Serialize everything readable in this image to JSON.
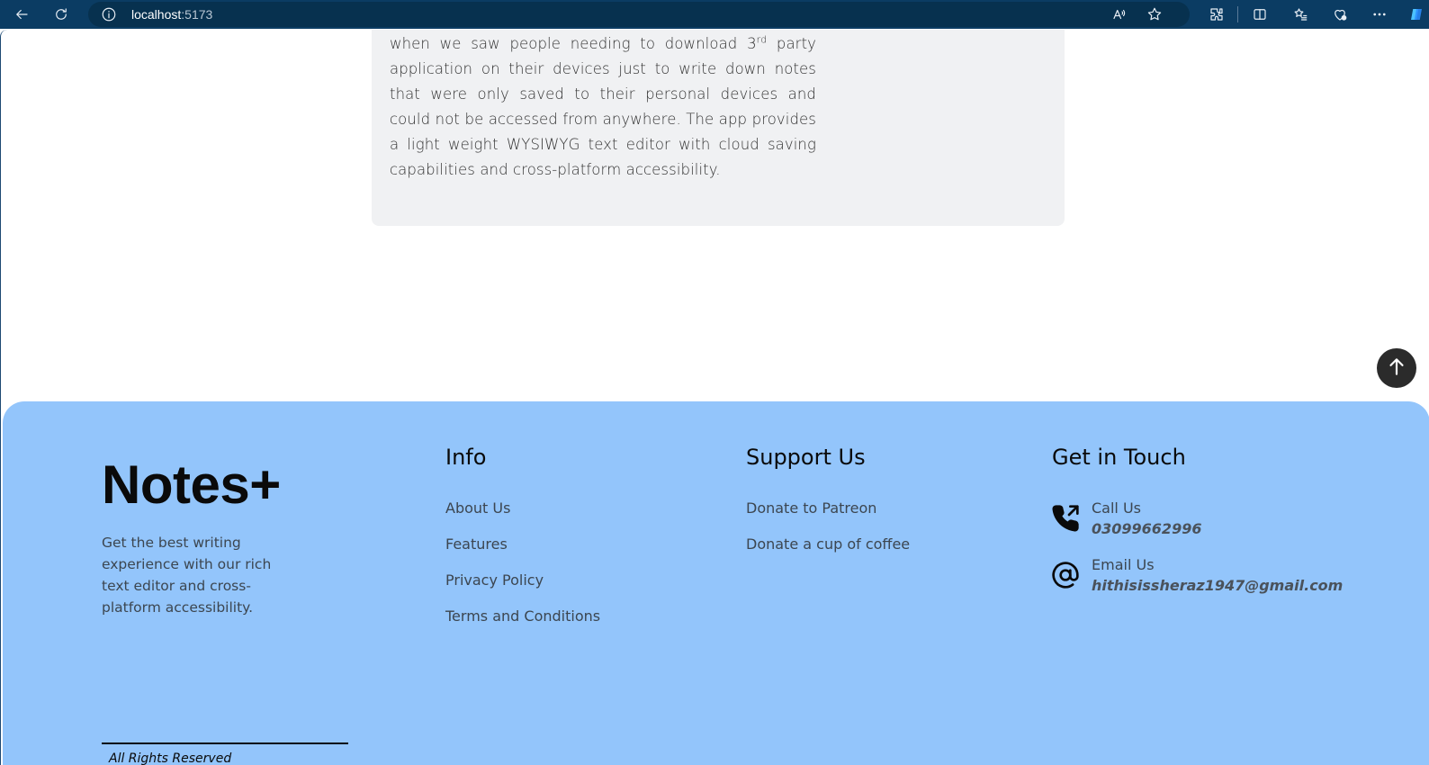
{
  "browser": {
    "url_host": "localhost",
    "url_port": ":5173"
  },
  "about": {
    "line1_prefix": "when we saw people needing to download 3",
    "line1_sup": "rd",
    "line1_suffix": " party application on their devices just to write down notes that were only saved to their personal devices and could not be accessed from anywhere. The app provides a light weight WYSIWYG text editor with cloud saving capabilities and cross-platform accessibility."
  },
  "footer": {
    "brand": "Notes+",
    "tagline": "Get the best writing experience with our rich text editor and cross-platform accessibility.",
    "info": {
      "title": "Info",
      "links": [
        "About Us",
        "Features",
        "Privacy Policy",
        "Terms and Conditions"
      ]
    },
    "support": {
      "title": "Support Us",
      "links": [
        "Donate to Patreon",
        "Donate a cup of coffee"
      ]
    },
    "contact": {
      "title": "Get in Touch",
      "call_label": "Call Us",
      "call_value": "03099662996",
      "email_label": "Email Us",
      "email_value": "hithisissheraz1947@gmail.com"
    },
    "rights": "All Rights Reserved"
  },
  "colors": {
    "chrome": "#0b3c63",
    "footer_bg": "#93c5fb",
    "card_bg": "#f0f1f3"
  }
}
